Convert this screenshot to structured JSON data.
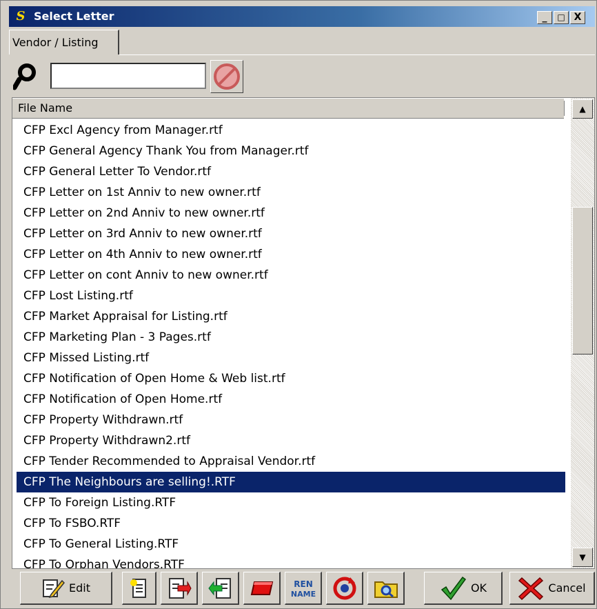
{
  "window": {
    "title": "Select Letter",
    "app_icon_letter": "S",
    "controls": {
      "minimize": "_",
      "maximize": "□",
      "close": "X"
    }
  },
  "tabs": [
    {
      "label": "Vendor / Listing",
      "active": true
    }
  ],
  "search": {
    "value": "",
    "placeholder": ""
  },
  "list": {
    "column_header": "File Name",
    "selected_index": 17,
    "selection_color": "#0a246a",
    "items": [
      "CFP Excl Agency from Manager.rtf",
      "CFP General Agency Thank You from Manager.rtf",
      "CFP General Letter To Vendor.rtf",
      "CFP Letter on 1st Anniv to new owner.rtf",
      "CFP Letter on 2nd Anniv to new owner.rtf",
      "CFP Letter on 3rd Anniv to new owner.rtf",
      "CFP Letter on 4th Anniv to new owner.rtf",
      "CFP Letter on cont Anniv to new owner.rtf",
      "CFP Lost Listing.rtf",
      "CFP Market Appraisal for Listing.rtf",
      "CFP Marketing Plan - 3 Pages.rtf",
      "CFP Missed Listing.rtf",
      "CFP Notification of Open Home & Web list.rtf",
      "CFP Notification of Open Home.rtf",
      "CFP Property Withdrawn.rtf",
      "CFP Property Withdrawn2.rtf",
      "CFP Tender Recommended to Appraisal Vendor.rtf",
      "CFP The Neighbours are selling!.RTF",
      "CFP To Foreign Listing.RTF",
      "CFP To FSBO.RTF",
      "CFP To General Listing.RTF",
      "CFP To Orphan Vendors.RTF"
    ]
  },
  "toolbar": {
    "edit_label": "Edit",
    "ok_label": "OK",
    "cancel_label": "Cancel",
    "rename_icon_text": "REN NAME",
    "icons": [
      "edit-icon",
      "new-document-icon",
      "import-icon",
      "export-icon",
      "eraser-icon",
      "rename-icon",
      "refresh-icon",
      "browse-folder-icon",
      "ok-check-icon",
      "cancel-x-icon"
    ]
  }
}
